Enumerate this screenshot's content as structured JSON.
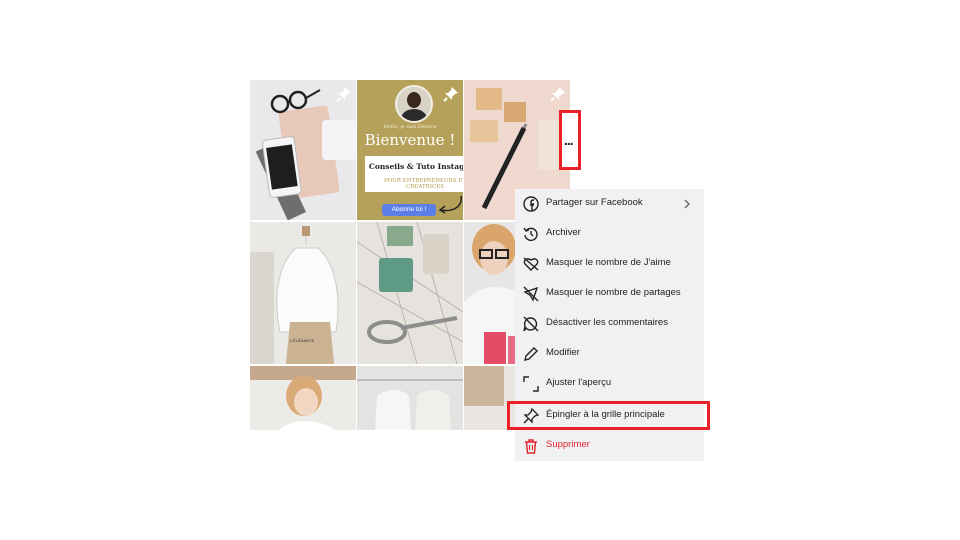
{
  "post_grid": {
    "center_tile": {
      "greeting": "Hello, je suis Debora",
      "welcome": "Bienvenue !",
      "headline": "Conseils & Tuto Instagram",
      "subheadline": "POUR ENTREPRENEURS ET CRÉATRICES",
      "cta": "Abonne toi !"
    },
    "dress_form_tag": "L'ÉLÉGANTE"
  },
  "more_button": {
    "label": "..."
  },
  "menu": {
    "items": [
      {
        "label": "Partager sur Facebook",
        "icon": "facebook-icon",
        "submenu": true
      },
      {
        "label": "Archiver",
        "icon": "archive-icon"
      },
      {
        "label": "Masquer le nombre de J'aime",
        "icon": "hide-likes-icon"
      },
      {
        "label": "Masquer le nombre de partages",
        "icon": "hide-shares-icon"
      },
      {
        "label": "Désactiver les commentaires",
        "icon": "comments-off-icon"
      },
      {
        "label": "Modifier",
        "icon": "pencil-icon"
      },
      {
        "label": "Ajuster l'aperçu",
        "icon": "adjust-preview-icon"
      },
      {
        "label": "Épingler à la grille principale",
        "icon": "pin-icon",
        "highlighted": true
      },
      {
        "label": "Supprimer",
        "icon": "trash-icon",
        "danger": true
      }
    ]
  },
  "colors": {
    "highlight": "#ec2127",
    "danger": "#e0252a",
    "menu_bg": "#f1f1f3",
    "cta": "#5b7fe6",
    "gold": "#b6a15a"
  }
}
